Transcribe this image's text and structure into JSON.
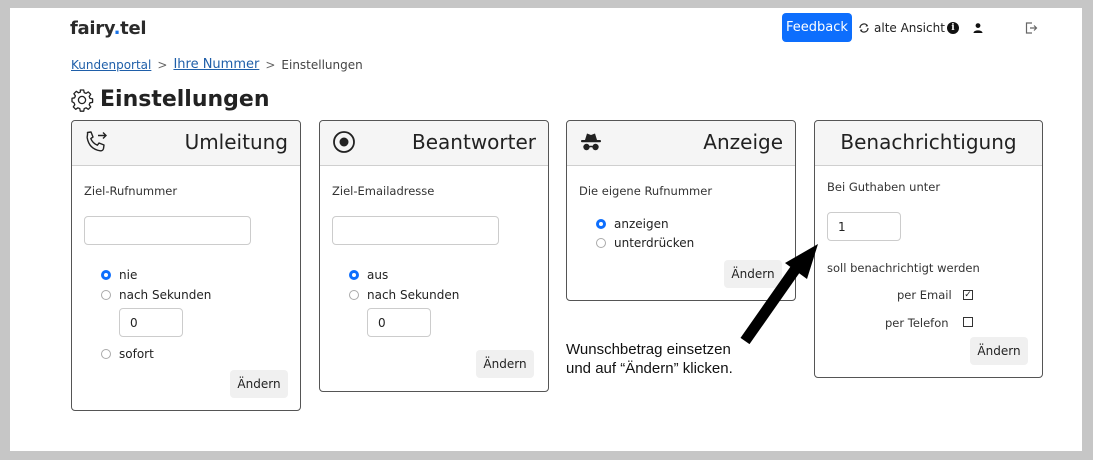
{
  "header": {
    "logo_prefix": "fairy",
    "logo_dot": ".",
    "logo_suffix": "tel",
    "feedback_label": "Feedback",
    "old_view_label": "alte Ansicht",
    "icons": [
      "sync-icon",
      "info-icon",
      "user-icon",
      "logout-icon"
    ]
  },
  "breadcrumb": {
    "items": [
      "Kundenportal",
      "Ihre Nummer",
      "Einstellungen"
    ],
    "separator": ">"
  },
  "page_title": "Einstellungen",
  "cards": {
    "umleitung": {
      "title": "Umleitung",
      "field_label": "Ziel-Rufnummer",
      "field_value": "",
      "options": [
        "nie",
        "nach Sekunden",
        "sofort"
      ],
      "selected": "nie",
      "seconds_value": "0",
      "button": "Ändern"
    },
    "beantworter": {
      "title": "Beantworter",
      "field_label": "Ziel-Emailadresse",
      "field_value": "",
      "options": [
        "aus",
        "nach Sekunden"
      ],
      "selected": "aus",
      "seconds_value": "0",
      "button": "Ändern"
    },
    "anzeige": {
      "title": "Anzeige",
      "field_label": "Die eigene Rufnummer",
      "options": [
        "anzeigen",
        "unterdrücken"
      ],
      "selected": "anzeigen",
      "button": "Ändern"
    },
    "benachrichtigung": {
      "title": "Benachrichtigung",
      "threshold_label": "Bei Guthaben unter",
      "threshold_value": "1",
      "notify_label": "soll benachrichtigt werden",
      "per_email_label": "per Email",
      "per_email_checked": true,
      "per_phone_label": "per Telefon",
      "per_phone_checked": false,
      "button": "Ändern"
    }
  },
  "annotation": {
    "line1": "Wunschbetrag einsetzen",
    "line2": "und auf “Ändern” klicken."
  },
  "colors": {
    "accent": "#0d6efd",
    "link": "#1f5fa9",
    "frame": "#c6c6c6"
  }
}
